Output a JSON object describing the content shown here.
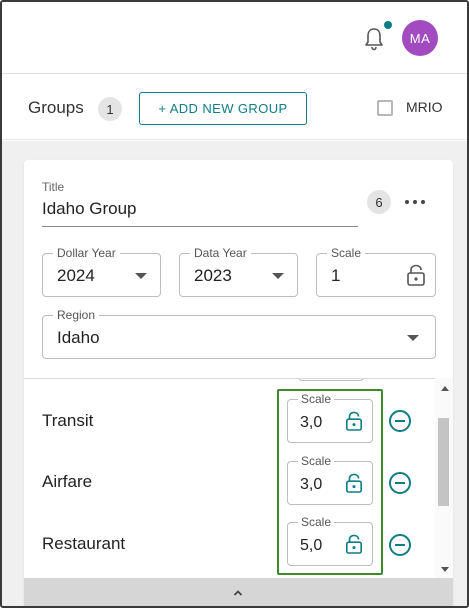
{
  "header": {
    "notification_icon": "bell-icon",
    "notification_dot_color": "#0e7d86",
    "avatar_initials": "MA",
    "avatar_color": "#a24bc0"
  },
  "groups_bar": {
    "label": "Groups",
    "count": "1",
    "add_button_label": "+ ADD NEW GROUP",
    "mrio_label": "MRIO",
    "mrio_checked": false
  },
  "group_card": {
    "title_label": "Title",
    "title_value": "Idaho Group",
    "item_count": "6",
    "more_icon": "more-horizontal-icon",
    "dollar_year": {
      "label": "Dollar Year",
      "value": "2024"
    },
    "data_year": {
      "label": "Data Year",
      "value": "2023"
    },
    "scale": {
      "label": "Scale",
      "value": "1",
      "icon": "lock-open-icon"
    },
    "region": {
      "label": "Region",
      "value": "Idaho"
    }
  },
  "items": [
    {
      "name": "Transit",
      "scale_label": "Scale",
      "scale_value": "3,0"
    },
    {
      "name": "Airfare",
      "scale_label": "Scale",
      "scale_value": "3,0"
    },
    {
      "name": "Restaurant",
      "scale_label": "Scale",
      "scale_value": "5,0"
    }
  ],
  "colors": {
    "accent": "#0e7d86",
    "highlight_border": "#3b8a2e"
  }
}
